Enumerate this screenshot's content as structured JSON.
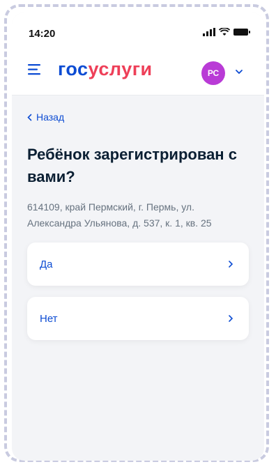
{
  "statusbar": {
    "time": "14:20",
    "icons": [
      "signal-icon",
      "wifi-icon",
      "battery-icon"
    ]
  },
  "header": {
    "logo_part1": "гос",
    "logo_part2": "услуги",
    "avatar_initials": "РС",
    "brand_blue": "#0d4cd3",
    "brand_red": "#ee3f58",
    "avatar_color": "#b93bd6"
  },
  "nav": {
    "back_label": "Назад"
  },
  "question": {
    "title": "Ребёнок зарегистрирован с вами?",
    "address": "614109, край Пермский, г. Пермь, ул. Александра Ульянова, д. 537, к. 1, кв. 25"
  },
  "options": [
    {
      "label": "Да"
    },
    {
      "label": "Нет"
    }
  ]
}
